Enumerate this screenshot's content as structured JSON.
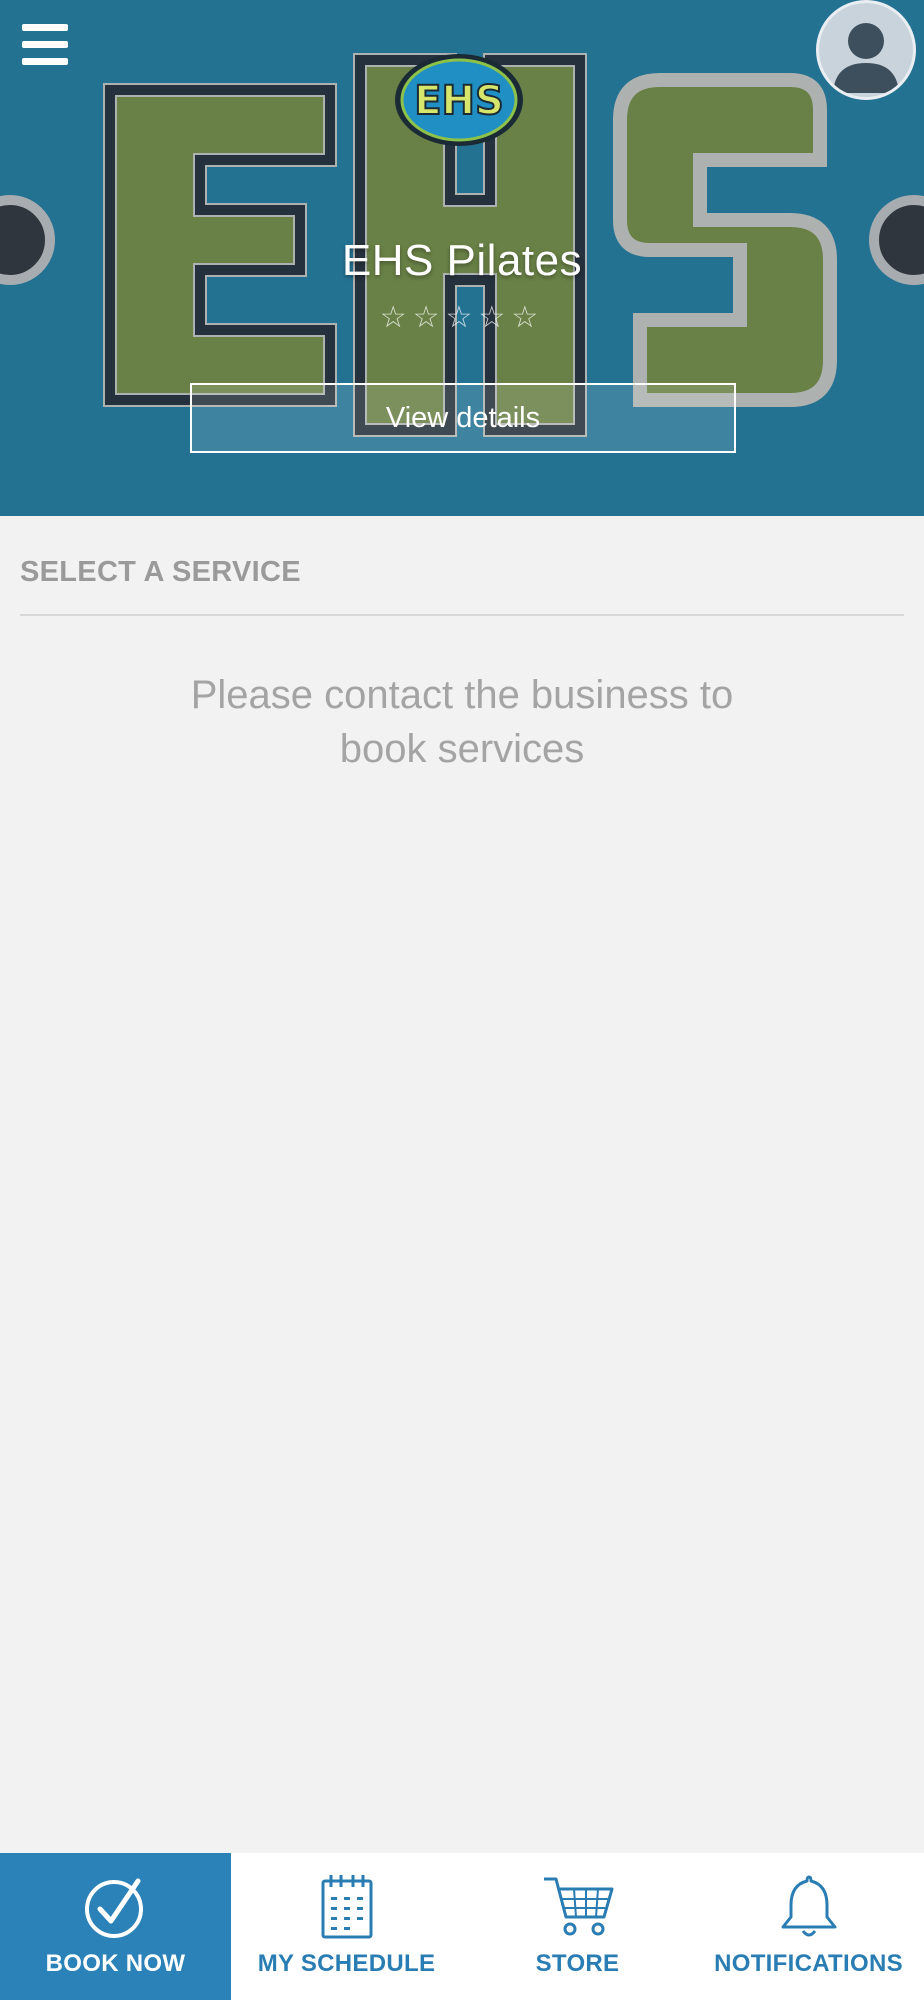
{
  "header": {
    "business_name": "EHS Pilates",
    "rating_stars": "☆☆☆☆☆",
    "rating_value": 0,
    "view_details_label": "View details",
    "logo_text": "EHS"
  },
  "services": {
    "section_title": "SELECT A SERVICE",
    "empty_message": "Please contact the business to book services"
  },
  "bottom_nav": {
    "items": [
      {
        "label": "BOOK NOW",
        "icon": "check-circle-icon",
        "active": true
      },
      {
        "label": "MY SCHEDULE",
        "icon": "calendar-icon",
        "active": false
      },
      {
        "label": "STORE",
        "icon": "cart-icon",
        "active": false
      },
      {
        "label": "NOTIFICATIONS",
        "icon": "bell-icon",
        "active": false
      }
    ]
  },
  "colors": {
    "accent": "#2a82b8",
    "nav_text": "#2a7db3",
    "background": "#f2f2f2"
  }
}
